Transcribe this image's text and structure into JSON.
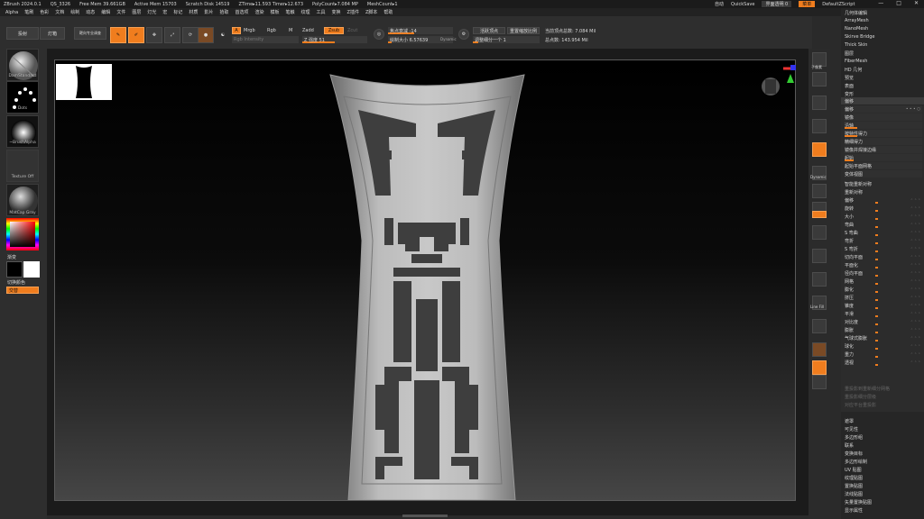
{
  "titlebar": {
    "app": "ZBrush 2024.0.1",
    "doc": "QS_3326",
    "free_mem": "Free Mem 39.661GB",
    "active_mem": "Active Mem 15703",
    "scratch": "Scratch Disk 14519",
    "ztime": "ZTime▸11.593 Timer▸12.673",
    "polycount": "PolyCount▸7.084 MP",
    "meshcount": "MeshCount▸1",
    "autosave": "自动",
    "quicksave": "QuickSave",
    "transparency": "界面透明 0",
    "menu_btn": "菜单",
    "script": "DefaultZScript"
  },
  "menubar": [
    "Alpha",
    "笔刷",
    "色彩",
    "文档",
    "绘制",
    "动态",
    "编辑",
    "文件",
    "图层",
    "灯光",
    "宏",
    "标记",
    "材质",
    "影片",
    "拾取",
    "首选项",
    "渲染",
    "模板",
    "笔触",
    "纹理",
    "工具",
    "变换",
    "Z插件",
    "Z脚本",
    "帮助"
  ],
  "topshelf": {
    "projection_master": "投射",
    "lightbox": "灯箱",
    "lightbox2": "靶向专业调查",
    "edit": "Edit",
    "draw": "Draw",
    "move": "Move",
    "scale": "Scale",
    "rotate": "Rotate",
    "a_label": "A",
    "mrgb": "Mrgb",
    "rgb": "Rgb",
    "m": "M",
    "zadd": "Zadd",
    "zsub": "Zsub",
    "zcut": "Zcut",
    "rgb_intensity": "Rgb Intensity",
    "z_intensity": "Z 强度 51",
    "focal_shift": "焦点衰减 -14",
    "draw_size": "绘制大小 6.57639",
    "dynamic": "Dynamic",
    "active_points": "活跃顶点",
    "active_points2": "重置缩放比例",
    "subdiv": "调整细分一个 1",
    "total_points_label": "当前顶点总数: 7.084 Mil",
    "total_points": "总点数: 143.954 Mil"
  },
  "leftshelf": {
    "brush": "DamStandard",
    "stroke": "Dots",
    "alpha": "~BrushAlpha",
    "texture": "Texture Off",
    "material": "MatCap Gray",
    "gradient": "渐变",
    "switch_color": "切换颜色",
    "alternate": "交替"
  },
  "rightshelf": [
    "子像素",
    "",
    "",
    "",
    "",
    "",
    "",
    "",
    "Dynamic",
    "",
    "",
    "",
    "Line Fill",
    "",
    "",
    "",
    "",
    ""
  ],
  "tray": {
    "top_items": [
      "几何体编辑",
      "ArrayMesh",
      "NanoMesh",
      "Skirve Bridge",
      "Thick Skin",
      "图层",
      "FiberMesh",
      "HD 几何",
      "预览",
      "表面",
      "变形"
    ],
    "deform_header": "偏移",
    "deform_items": [
      {
        "label": "偏移",
        "val": "• • • ○"
      },
      {
        "label": "镜像",
        "val": ""
      },
      {
        "label": "沿轴",
        "val": ""
      },
      {
        "label": "按特性得力",
        "val": ""
      },
      {
        "label": "精细得力",
        "val": ""
      },
      {
        "label": "镜像并焊接边缘",
        "val": ""
      },
      {
        "label": "起始",
        "val": ""
      },
      {
        "label": "起始平面网格",
        "val": ""
      },
      {
        "label": "变体视图",
        "val": ""
      }
    ],
    "deform_controls": [
      {
        "label": "智能重新对称"
      },
      {
        "label": "重新对称"
      },
      {
        "label": "偏移"
      },
      {
        "label": "旋转"
      },
      {
        "label": "大小"
      },
      {
        "label": "弯曲"
      },
      {
        "label": "S 弯曲"
      },
      {
        "label": "弯折"
      },
      {
        "label": "S 弯折"
      },
      {
        "label": "切向平面"
      },
      {
        "label": "平面化"
      },
      {
        "label": "径向平面"
      },
      {
        "label": "网格"
      },
      {
        "label": "膨化"
      },
      {
        "label": "挤压"
      },
      {
        "label": "锥度"
      },
      {
        "label": "平滑"
      },
      {
        "label": "对比度"
      },
      {
        "label": "膨胀"
      },
      {
        "label": "气球式膨胀"
      },
      {
        "label": "球化"
      },
      {
        "label": "重力"
      },
      {
        "label": "透视"
      }
    ],
    "dim_items": [
      "重投影到重新细分网格",
      "重投影细分层级",
      "投射",
      "对应平台重投影"
    ],
    "bottom_items": [
      "遮罩",
      "可见性",
      "多边形组",
      "联系",
      "变换目标",
      "多边形绘制",
      "UV 贴图",
      "纹理贴图",
      "置换贴图",
      "法线贴图",
      "矢量置换贴图",
      "显示属性"
    ]
  },
  "colors": {
    "accent": "#f07d1e",
    "panel": "#2e2e2e",
    "canvas_bg": "#000000"
  }
}
